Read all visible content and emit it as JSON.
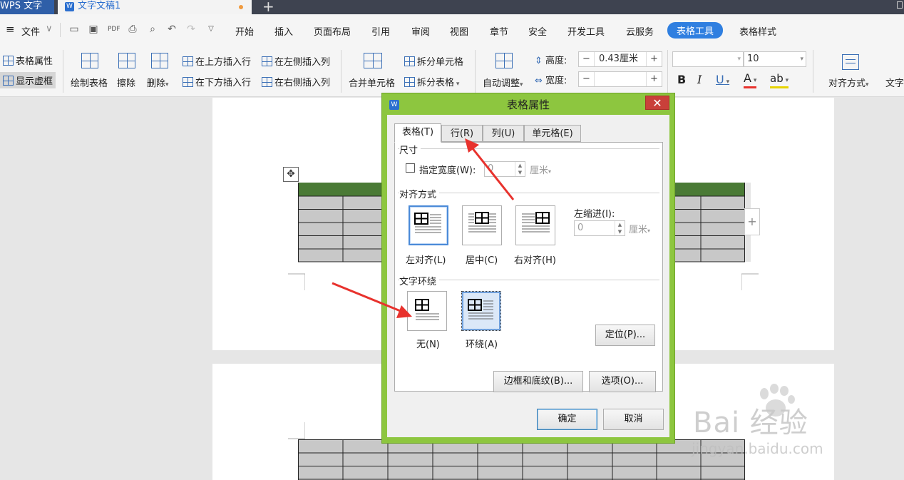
{
  "titlebar": {
    "app_tab": "WPS 文字",
    "doc_tab": "文字文稿1",
    "doc_icon": "W",
    "new_tab": "+"
  },
  "menu": {
    "file": "文件",
    "items": [
      "开始",
      "插入",
      "页面布局",
      "引用",
      "审阅",
      "视图",
      "章节",
      "安全",
      "开发工具",
      "云服务",
      "表格工具",
      "表格样式"
    ],
    "active": "表格工具"
  },
  "ribbon": {
    "table_props": "表格属性",
    "show_gridlines": "显示虚框",
    "draw_table": "绘制表格",
    "erase": "擦除",
    "delete": "删除",
    "insert_row_above": "在上方插入行",
    "insert_row_below": "在下方插入行",
    "insert_col_left": "在左侧插入列",
    "insert_col_right": "在右侧插入列",
    "merge_cells": "合并单元格",
    "split_cells": "拆分单元格",
    "split_table": "拆分表格",
    "auto_fit": "自动调整",
    "height_label": "高度:",
    "height_value": "0.43厘米",
    "width_label": "宽度:",
    "width_value": "",
    "font_size": "10",
    "bold": "B",
    "italic": "I",
    "underline": "U",
    "font_color": "A",
    "highlight": "ab",
    "align": "对齐方式",
    "text_dir": "文字"
  },
  "dialog": {
    "title": "表格属性",
    "logo": "W",
    "tabs": [
      "表格(T)",
      "行(R)",
      "列(U)",
      "单元格(E)"
    ],
    "size_group": "尺寸",
    "specify_width": "指定宽度(W):",
    "width_value": "0",
    "width_unit": "厘米",
    "align_group": "对齐方式",
    "align_options": [
      "左对齐(L)",
      "居中(C)",
      "右对齐(H)"
    ],
    "indent_label": "左缩进(I):",
    "indent_value": "0",
    "indent_unit": "厘米",
    "wrap_group": "文字环绕",
    "wrap_options": [
      "无(N)",
      "环绕(A)"
    ],
    "position_btn": "定位(P)...",
    "borders_btn": "边框和底纹(B)...",
    "options_btn": "选项(O)...",
    "ok": "确定",
    "cancel": "取消"
  },
  "watermark": {
    "logo": "Bai 经验",
    "url": "jingyan.baidu.com"
  },
  "colors": {
    "accent": "#2f7fe0",
    "dialog_frame": "#8dc63f",
    "close": "#c9403a",
    "table_header": "#4a7a35",
    "table_cell": "#c8c8c8",
    "arrow": "#e8322d"
  }
}
